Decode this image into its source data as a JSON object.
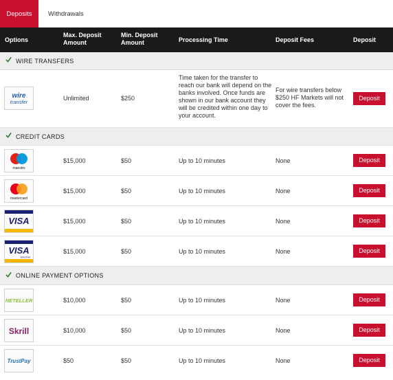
{
  "tabs": [
    {
      "label": "Deposits",
      "active": true
    },
    {
      "label": "Withdrawals",
      "active": false
    }
  ],
  "columns": {
    "options": "Options",
    "max_deposit_line1": "Max. Deposit",
    "max_deposit_line2": "Amount",
    "min_deposit_line1": "Min. Deposit",
    "min_deposit_line2": "Amount",
    "processing_time": "Processing Time",
    "deposit_fees": "Deposit Fees",
    "deposit": "Deposit"
  },
  "sections": {
    "wire": {
      "title": "WIRE TRANSFERS",
      "rows": [
        {
          "logo": {
            "name": "wire-transfer-logo",
            "line1": "wire",
            "line2": "transfer"
          },
          "max": "Unlimited",
          "min": "$250",
          "time_lines": [
            "Time taken for the transfer to",
            "reach our bank will depend on the",
            "banks involved. Once funds are",
            "shown in our bank account they",
            "will be credited within one day to",
            "your account."
          ],
          "fee_lines": [
            "For wire transfers below",
            "$250 HF Markets will not",
            "cover the fees."
          ],
          "button": "Deposit"
        }
      ]
    },
    "cards": {
      "title": "CREDIT CARDS",
      "rows": [
        {
          "logo": {
            "name": "maestro-logo",
            "text": "maestro"
          },
          "max": "$15,000",
          "min": "$50",
          "time": "Up to 10 minutes",
          "fee": "None",
          "button": "Deposit"
        },
        {
          "logo": {
            "name": "mastercard-logo",
            "text": "mastercard"
          },
          "max": "$15,000",
          "min": "$50",
          "time": "Up to 10 minutes",
          "fee": "None",
          "button": "Deposit"
        },
        {
          "logo": {
            "name": "visa-logo",
            "text": "VISA"
          },
          "max": "$15,000",
          "min": "$50",
          "time": "Up to 10 minutes",
          "fee": "None",
          "button": "Deposit"
        },
        {
          "logo": {
            "name": "visa-electron-logo",
            "text": "VISA",
            "sub": "Electron"
          },
          "max": "$15,000",
          "min": "$50",
          "time": "Up to 10 minutes",
          "fee": "None",
          "button": "Deposit"
        }
      ]
    },
    "online": {
      "title": "ONLINE PAYMENT OPTIONS",
      "rows": [
        {
          "logo": {
            "name": "neteller-logo",
            "text": "NETELLER"
          },
          "max": "$10,000",
          "min": "$50",
          "time": "Up to 10 minutes",
          "fee": "None",
          "button": "Deposit"
        },
        {
          "logo": {
            "name": "skrill-logo",
            "text": "Skrill"
          },
          "max": "$10,000",
          "min": "$50",
          "time": "Up to 10 minutes",
          "fee": "None",
          "button": "Deposit"
        },
        {
          "logo": {
            "name": "trustpay-logo",
            "text": "TrustPay"
          },
          "max": "$50",
          "min": "$50",
          "time": "Up to 10 minutes",
          "fee": "None",
          "button": "Deposit"
        }
      ]
    }
  },
  "colors": {
    "accent": "#c8102e",
    "header_bg": "#1a1a1a",
    "section_bg": "#eeeeee",
    "check": "#2e7d32"
  }
}
